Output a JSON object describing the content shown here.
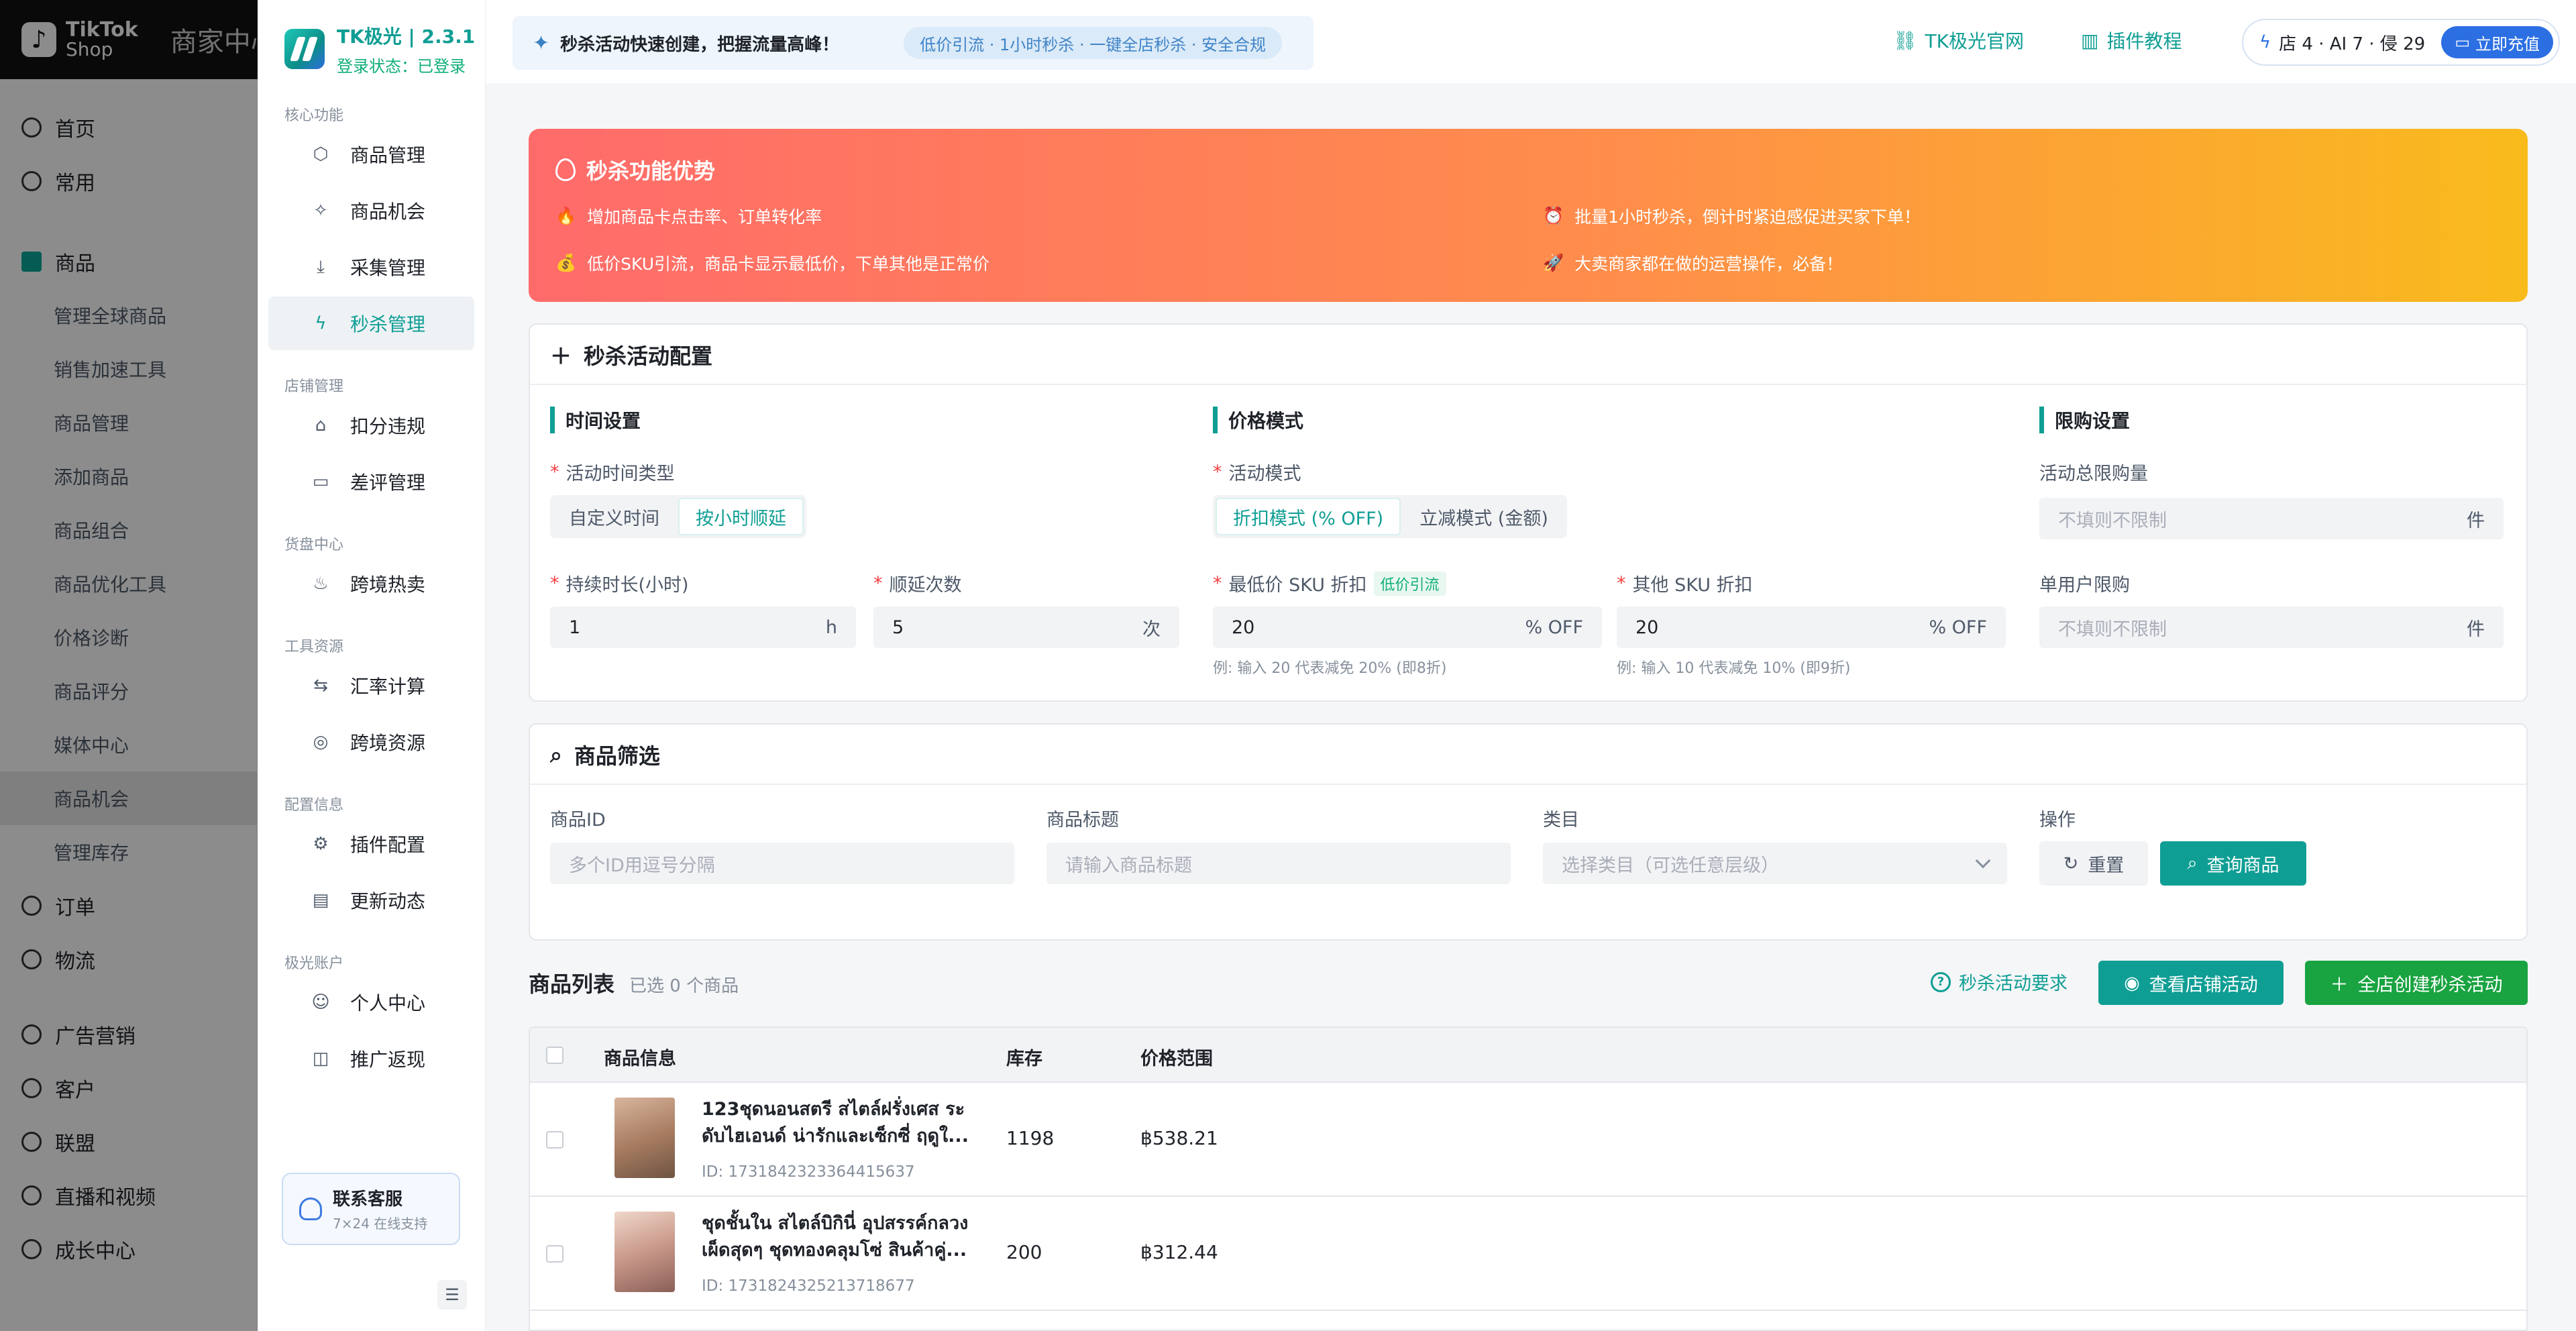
{
  "tiktok": {
    "brand_line1": "TikTok",
    "brand_line2": "Shop",
    "center_title": "商家中心",
    "menu": [
      {
        "label": "首页",
        "type": "top"
      },
      {
        "label": "常用",
        "type": "top"
      }
    ],
    "product_group": "商品",
    "product_subs": [
      "管理全球商品",
      "销售加速工具",
      "商品管理",
      "添加商品",
      "商品组合",
      "商品优化工具",
      "价格诊断",
      "商品评分",
      "媒体中心",
      "商品机会",
      "管理库存"
    ],
    "selected_sub": "商品机会",
    "bottom_menu": [
      "订单",
      "物流",
      "广告营销",
      "客户",
      "联盟",
      "直播和视频",
      "成长中心"
    ]
  },
  "plugin": {
    "name": "TK极光 | 2.3.1",
    "status": "登录状态：已登录",
    "groups": [
      {
        "title": "核心功能",
        "items": [
          {
            "label": "商品管理",
            "icon": "cube-icon"
          },
          {
            "label": "商品机会",
            "icon": "sparkles-icon"
          },
          {
            "label": "采集管理",
            "icon": "download-icon"
          },
          {
            "label": "秒杀管理",
            "icon": "lightning-icon",
            "active": true
          }
        ]
      },
      {
        "title": "店铺管理",
        "items": [
          {
            "label": "扣分违规",
            "icon": "store-icon"
          },
          {
            "label": "差评管理",
            "icon": "message-icon"
          }
        ]
      },
      {
        "title": "货盘中心",
        "items": [
          {
            "label": "跨境热卖",
            "icon": "flame-icon"
          }
        ]
      },
      {
        "title": "工具资源",
        "items": [
          {
            "label": "汇率计算",
            "icon": "swap-icon"
          },
          {
            "label": "跨境资源",
            "icon": "globe-icon"
          }
        ]
      },
      {
        "title": "配置信息",
        "items": [
          {
            "label": "插件配置",
            "icon": "gear-icon"
          },
          {
            "label": "更新动态",
            "icon": "news-icon"
          }
        ]
      },
      {
        "title": "极光账户",
        "items": [
          {
            "label": "个人中心",
            "icon": "user-icon"
          },
          {
            "label": "推广返现",
            "icon": "gift-icon"
          }
        ]
      }
    ],
    "support_title": "联系客服",
    "support_sub": "7×24 在线支持"
  },
  "topbar": {
    "announce_text": "秒杀活动快速创建，把握流量高峰！",
    "announce_tag": "低价引流 · 1小时秒杀 · 一键全店秒杀 · 安全合规",
    "link_site": "TK极光官网",
    "link_tutorial": "插件教程",
    "quota_text": "店 4 · AI 7 · 侵 29",
    "recharge_label": "立即充值"
  },
  "hero": {
    "title": "秒杀功能优势",
    "items": [
      "增加商品卡点击率、订单转化率",
      "批量1小时秒杀，倒计时紧迫感促进买家下单！",
      "低价SKU引流，商品卡显示最低价，下单其他是正常价",
      "大卖商家都在做的运营操作，必备！"
    ]
  },
  "config": {
    "title": "秒杀活动配置",
    "time_section": "时间设置",
    "time_type_label": "活动时间类型",
    "time_type_options": [
      "自定义时间",
      "按小时顺延"
    ],
    "time_type_selected": "按小时顺延",
    "duration_label": "持续时长(小时)",
    "duration_value": "1",
    "duration_unit": "h",
    "repeat_label": "顺延次数",
    "repeat_value": "5",
    "repeat_unit": "次",
    "price_section": "价格模式",
    "mode_label": "活动模式",
    "mode_options": [
      "折扣模式 (% OFF)",
      "立减模式 (金额)"
    ],
    "mode_selected": "折扣模式 (% OFF)",
    "low_sku_label": "最低价 SKU 折扣",
    "low_sku_tag": "低价引流",
    "low_sku_value": "20",
    "low_sku_unit": "% OFF",
    "low_sku_hint": "例: 输入 20 代表减免 20% (即8折)",
    "other_sku_label": "其他 SKU 折扣",
    "other_sku_value": "20",
    "other_sku_unit": "% OFF",
    "other_sku_hint": "例: 输入 10 代表减免 10% (即9折)",
    "limit_section": "限购设置",
    "total_limit_label": "活动总限购量",
    "total_limit_placeholder": "不填则不限制",
    "total_limit_unit": "件",
    "user_limit_label": "单用户限购",
    "user_limit_placeholder": "不填则不限制",
    "user_limit_unit": "件"
  },
  "filter": {
    "title": "商品筛选",
    "id_label": "商品ID",
    "id_placeholder": "多个ID用逗号分隔",
    "title_label": "商品标题",
    "title_placeholder": "请输入商品标题",
    "category_label": "类目",
    "category_placeholder": "选择类目（可选任意层级）",
    "action_label": "操作",
    "reset_label": "重置",
    "search_label": "查询商品"
  },
  "list": {
    "title": "商品列表",
    "selected_text": "已选 0 个商品",
    "requirements_label": "秒杀活动要求",
    "view_store_label": "查看店铺活动",
    "create_all_label": "全店创建秒杀活动",
    "columns": [
      "商品信息",
      "库存",
      "价格范围"
    ],
    "rows": [
      {
        "title": "123ชุดนอนสตรี สไตล์ฝรั่งเศส ระดับไฮเอนด์ น่ารักและเซ็กซี่ ฤดูใ...",
        "id": "ID: 1731842323364415637",
        "stock": "1198",
        "price": "฿538.21"
      },
      {
        "title": "ชุดชั้นใน สไตล์บิกินี่ อุปสรรค์กลวง เผ็ดสุดๆ ชุดทองคลุมโซ่ สินค้าคู่...",
        "id": "ID: 1731824325213718677",
        "stock": "200",
        "price": "฿312.44"
      }
    ]
  },
  "colors": {
    "accent": "#0f9e94",
    "create_button": "#19a341",
    "recharge": "#2c6fe3",
    "hero_start": "#ff6b6b",
    "hero_end": "#f9bb1c"
  }
}
